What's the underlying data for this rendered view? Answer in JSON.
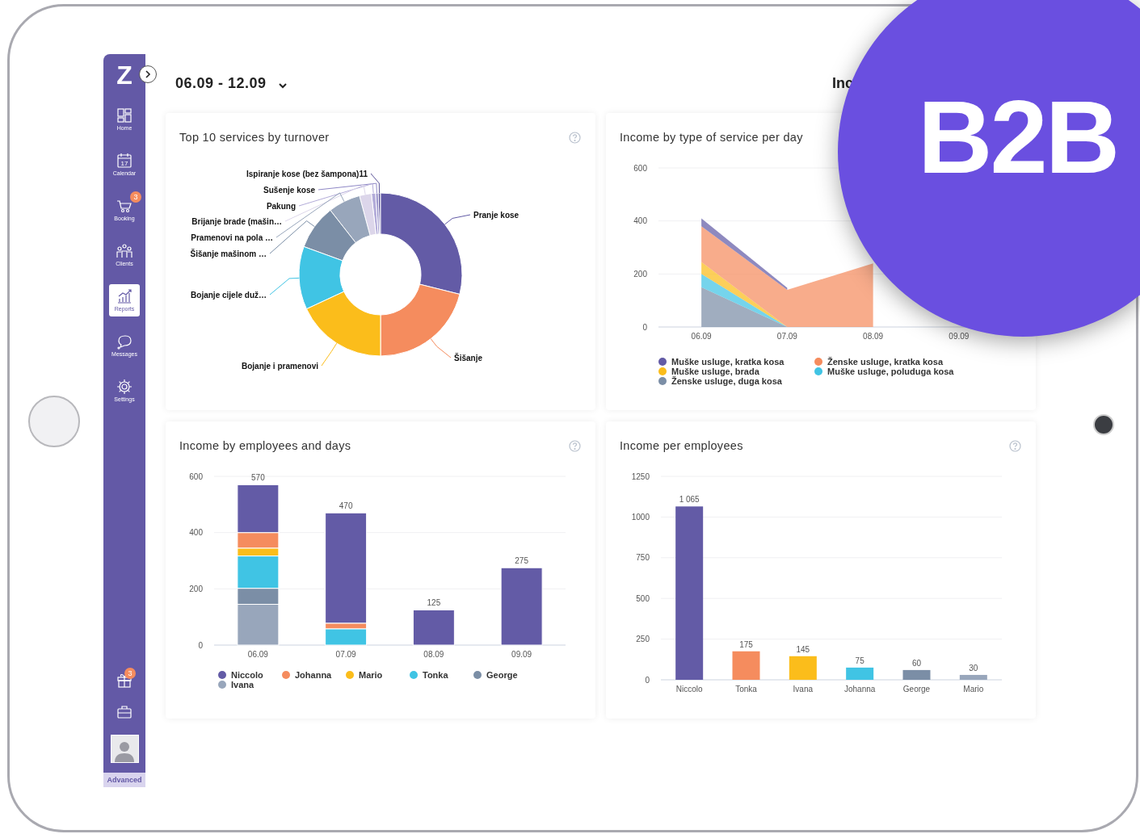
{
  "sidebar": {
    "logo": "Z",
    "items": [
      {
        "label": "Home",
        "selected": false
      },
      {
        "label": "Calendar",
        "selected": false,
        "date": "17"
      },
      {
        "label": "Booking",
        "selected": false,
        "badge": "3"
      },
      {
        "label": "Clients",
        "selected": false
      },
      {
        "label": "Reports",
        "selected": true
      },
      {
        "label": "Messages",
        "selected": false
      },
      {
        "label": "Settings",
        "selected": false
      }
    ],
    "gift_badge": "3",
    "plan": "Advanced"
  },
  "header": {
    "date_range": "06.09 - 12.09",
    "right_title": "Inc"
  },
  "cards": [
    {
      "kind": "donut",
      "title": "Top 10 services by turnover",
      "help": true,
      "slices": [
        {
          "label": "Ispiranje kose (bez šampona)11",
          "color": "#5b5398"
        },
        {
          "label": "Sušenje kose",
          "color": "#8f88c6"
        },
        {
          "label": "Pakung",
          "color": "#b3acd9"
        },
        {
          "label": "Pranje kose",
          "color": "#635ba6"
        },
        {
          "label": "Brijanje brade (mašin…",
          "color": "#dcd6ea"
        },
        {
          "label": "Pramenovi na pola …",
          "color": "#98a6bb"
        },
        {
          "label": "Šišanje mašinom …",
          "color": "#7b8ea6"
        },
        {
          "label": "Bojanje cijele duž…",
          "color": "#40c4e4"
        },
        {
          "label": "Šišanje",
          "color": "#f58c5e"
        },
        {
          "label": "Bojanje i pramenovi",
          "color": "#fbbd1b"
        }
      ]
    },
    {
      "kind": "area",
      "title": "Income by type of service per day",
      "chart_data": {
        "type": "area",
        "stacked": true,
        "grid": true,
        "categories": [
          "06.09",
          "07.09",
          "08.09",
          "09.09"
        ],
        "yticks": [
          0,
          200,
          400,
          600
        ],
        "ylim": [
          0,
          600
        ],
        "series": [
          {
            "name": "Muške usluge, kratka kosa",
            "color": "#635ba6",
            "values": [
              30,
              8,
              null,
              null
            ]
          },
          {
            "name": "Ženske usluge, kratka kosa",
            "color": "#f58c5e",
            "values": [
              135,
              140,
              240,
              null
            ]
          },
          {
            "name": "Muške usluge, brada",
            "color": "#fbbd1b",
            "values": [
              45,
              0,
              0,
              null
            ]
          },
          {
            "name": "Muške usluge, poluduga kosa",
            "color": "#40c4e4",
            "values": [
              50,
              0,
              0,
              null
            ]
          },
          {
            "name": "Ženske usluge, duga kosa",
            "color": "#7b8ea6",
            "values": [
              150,
              0,
              0,
              null
            ]
          }
        ]
      }
    },
    {
      "kind": "bar",
      "title": "Income by employees and days",
      "help": true,
      "chart_data": {
        "type": "bar",
        "stacked": true,
        "grid": true,
        "categories": [
          "06.09",
          "07.09",
          "08.09",
          "09.09"
        ],
        "yticks": [
          0,
          200,
          400,
          600
        ],
        "ylim": [
          0,
          600
        ],
        "value_labels": [
          "570",
          "470",
          "125",
          "275"
        ],
        "series": [
          {
            "name": "Niccolo",
            "color": "#635ba6",
            "values": [
              170,
              392,
              125,
              275
            ]
          },
          {
            "name": "Johanna",
            "color": "#f58c5e",
            "values": [
              55,
              20,
              0,
              0
            ]
          },
          {
            "name": "Mario",
            "color": "#fbbd1b",
            "values": [
              28,
              0,
              0,
              0
            ]
          },
          {
            "name": "Tonka",
            "color": "#40c4e4",
            "values": [
              115,
              58,
              0,
              0
            ]
          },
          {
            "name": "George",
            "color": "#7b8ea6",
            "values": [
              57,
              0,
              0,
              0
            ]
          },
          {
            "name": "Ivana",
            "color": "#98a6bb",
            "values": [
              145,
              0,
              0,
              0
            ]
          }
        ]
      }
    },
    {
      "kind": "bar",
      "title": "Income per employees",
      "help": true,
      "chart_data": {
        "type": "bar",
        "stacked": false,
        "grid": true,
        "categories": [
          "Niccolo",
          "Tonka",
          "Ivana",
          "Johanna",
          "George",
          "Mario"
        ],
        "yticks": [
          0,
          250,
          500,
          750,
          1000,
          1250
        ],
        "ylim": [
          0,
          1250
        ],
        "value_labels": [
          "1 065",
          "175",
          "145",
          "75",
          "60",
          "30"
        ],
        "colors": [
          "#635ba6",
          "#f58c5e",
          "#fbbd1b",
          "#40c4e4",
          "#7b8ea6",
          "#98a6bb"
        ],
        "series": [
          {
            "values": [
              1065,
              175,
              145,
              75,
              60,
              30
            ]
          }
        ]
      }
    }
  ],
  "badge": {
    "text": "B2B"
  }
}
